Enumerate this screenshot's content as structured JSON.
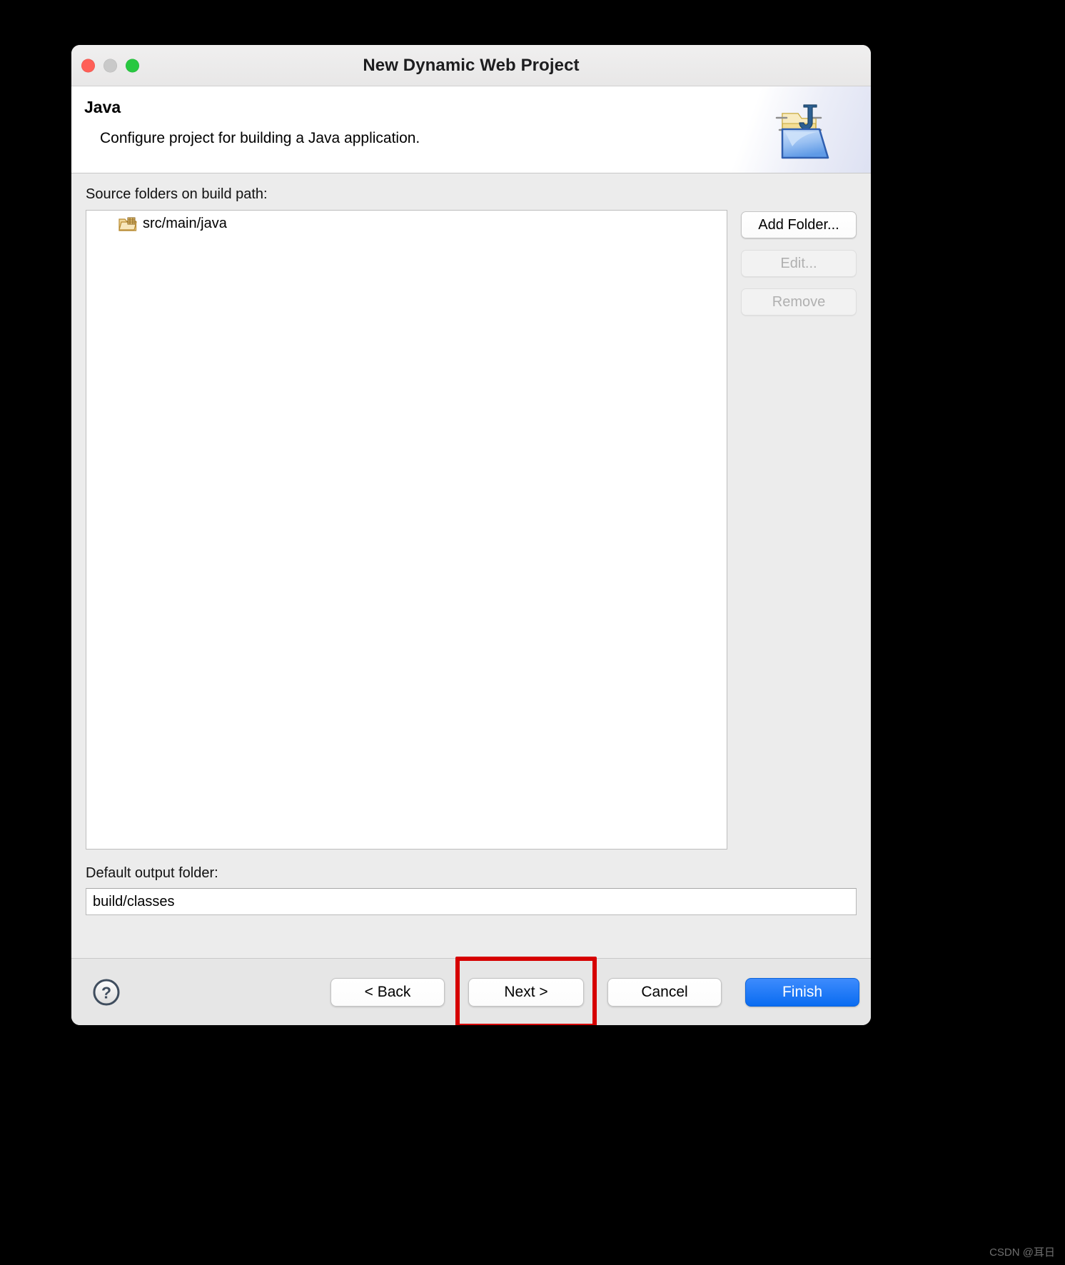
{
  "window": {
    "title": "New Dynamic Web Project",
    "traffic_lights": {
      "close": "close-button",
      "minimize": "minimize-button",
      "maximize": "maximize-button"
    }
  },
  "banner": {
    "title": "Java",
    "description": "Configure project for building a Java application.",
    "icon": "java-folder-wizard-icon"
  },
  "source_folders": {
    "label": "Source folders on build path:",
    "items": [
      {
        "icon": "source-folder-icon",
        "label": "src/main/java"
      }
    ],
    "buttons": [
      {
        "label": "Add Folder...",
        "enabled": true
      },
      {
        "label": "Edit...",
        "enabled": false
      },
      {
        "label": "Remove",
        "enabled": false
      }
    ]
  },
  "output_folder": {
    "label": "Default output folder:",
    "value": "build/classes",
    "placeholder": ""
  },
  "footer": {
    "help_icon": "question-mark-icon",
    "back_label": "< Back",
    "next_label": "Next >",
    "cancel_label": "Cancel",
    "finish_label": "Finish",
    "highlighted_button": "Next >",
    "highlight_color": "#d60000"
  },
  "watermark": {
    "text": "CSDN @耳日"
  },
  "colors": {
    "accent": "#0a6cf1",
    "window_background": "#ececec",
    "banner_background": "#ffffff",
    "highlight": "#d60000"
  }
}
